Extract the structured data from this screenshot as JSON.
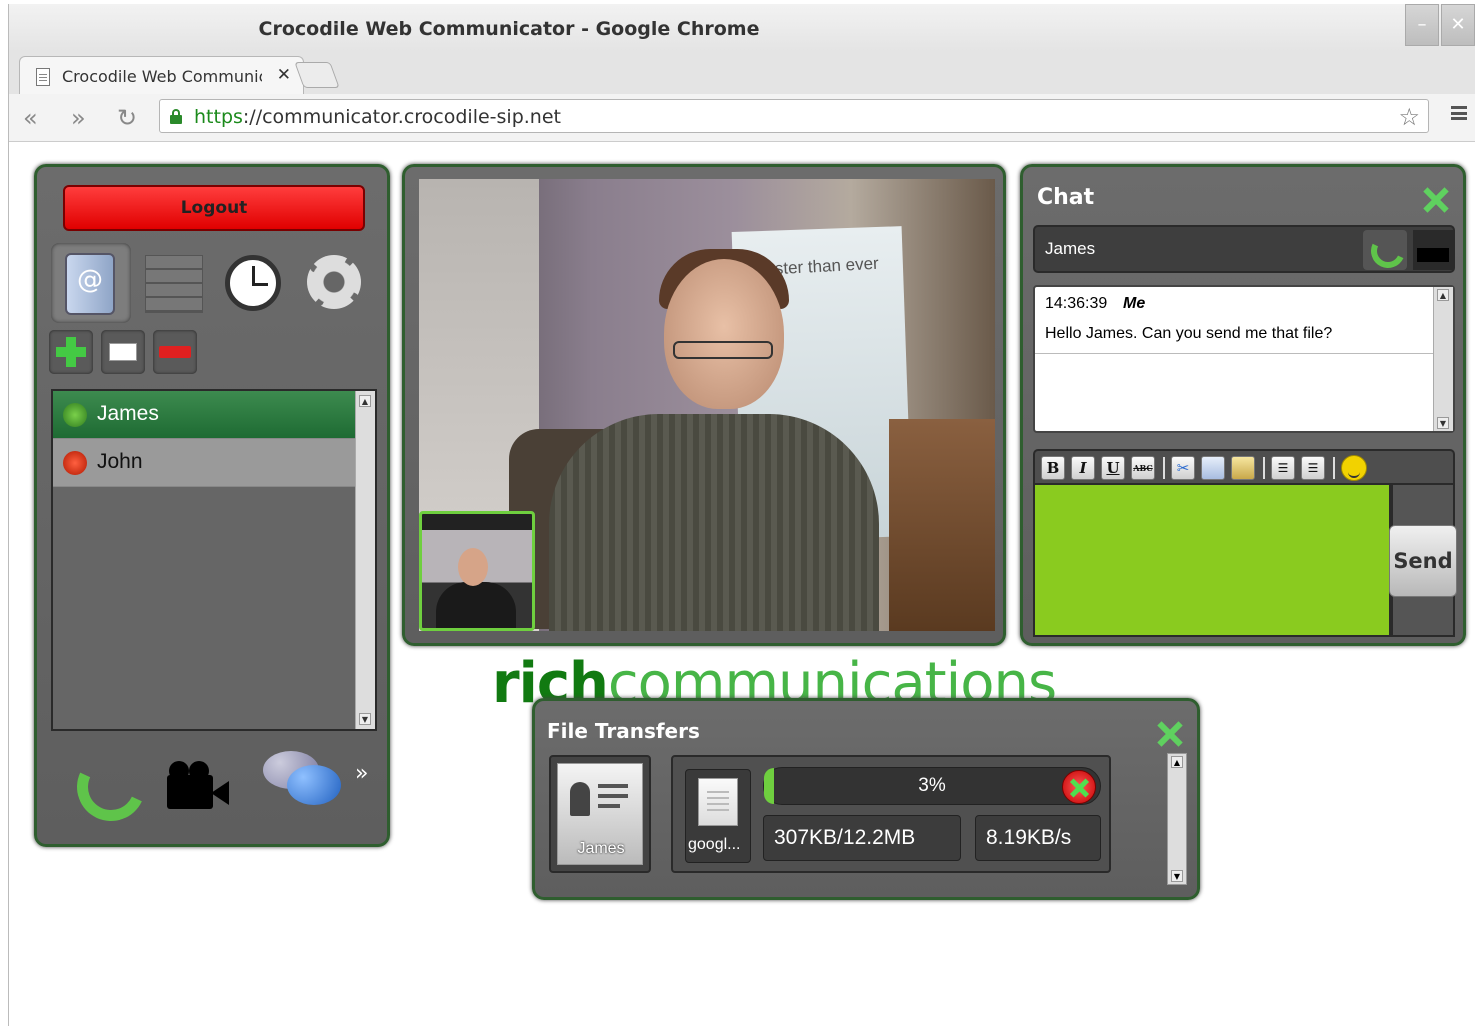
{
  "window": {
    "title": "Crocodile Web Communicator - Google Chrome"
  },
  "tab": {
    "label": "Crocodile Web Communica"
  },
  "omnibox": {
    "scheme": "https",
    "rest": "://communicator.crocodile-sip.net"
  },
  "left": {
    "logout_label": "Logout",
    "contacts": [
      {
        "name": "James",
        "status": "online",
        "selected": true
      },
      {
        "name": "John",
        "status": "offline",
        "selected": false
      }
    ],
    "more_label": "»"
  },
  "logo": {
    "rich": "rich",
    "comm": "communications"
  },
  "video": {
    "poster_text": "Faster than ever"
  },
  "chat": {
    "title": "Chat",
    "contact": "James",
    "messages": [
      {
        "time": "14:36:39",
        "sender": "Me",
        "text": "Hello James. Can you send me that file?"
      }
    ],
    "format_buttons": [
      "B",
      "I",
      "U",
      "ABC"
    ],
    "send_label": "Send",
    "input_color": "#8acb1f"
  },
  "file_transfers": {
    "title": "File Transfers",
    "contact": "James",
    "file_name": "googl...",
    "progress_label": "3%",
    "progress": 0.03,
    "size_label": "307KB/12.2MB",
    "speed_label": "8.19KB/s"
  },
  "colors": {
    "accent": "#5fd15f",
    "panel_border": "#2f5e2f",
    "logout": "#ff2020"
  }
}
